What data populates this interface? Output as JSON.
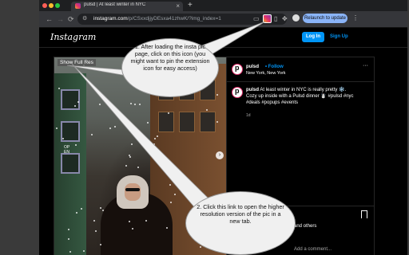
{
  "browser": {
    "tab_title": "pulsd | At least winter in NYC",
    "tab_close": "×",
    "new_tab": "+",
    "url_host": "instagram.com",
    "url_path": "/p/CSxxdjjyDEsxa41zhwK/?img_index=1",
    "relaunch_label": "Relaunch to update",
    "menu_dots": "⋮",
    "back": "←",
    "forward": "→",
    "reload": "⟳"
  },
  "instagram": {
    "logo": "Instagram",
    "login_label": "Log In",
    "signup_label": "Sign Up",
    "photo_button": "Show Full Res",
    "next_arrow": "›",
    "post": {
      "username": "pulsd",
      "follow_label": "• Follow",
      "location": "New York, New York",
      "more": "···",
      "caption_user": "pulsd",
      "caption_text": "At least winter in NYC is really pretty ❄️. Cozy up inside with a Pulsd dinner ☃️ #pulsd #nyc #deals #popups #events",
      "time": "1d",
      "liked_by": "and others",
      "comment_placeholder": "Add a comment..."
    },
    "door_text": "OPEN"
  },
  "annotations": {
    "callout_1": "1. After loading the insta pic page, click on this icon (you might want to pin the extension icon for easy access)",
    "callout_2": "2. Click this link to open the higher resolution version of the pic in a new tab."
  },
  "colors": {
    "instagram_blue": "#0095f6",
    "relaunch_blue": "#8ab4f8",
    "callout_bg": "#f0f0f0"
  }
}
